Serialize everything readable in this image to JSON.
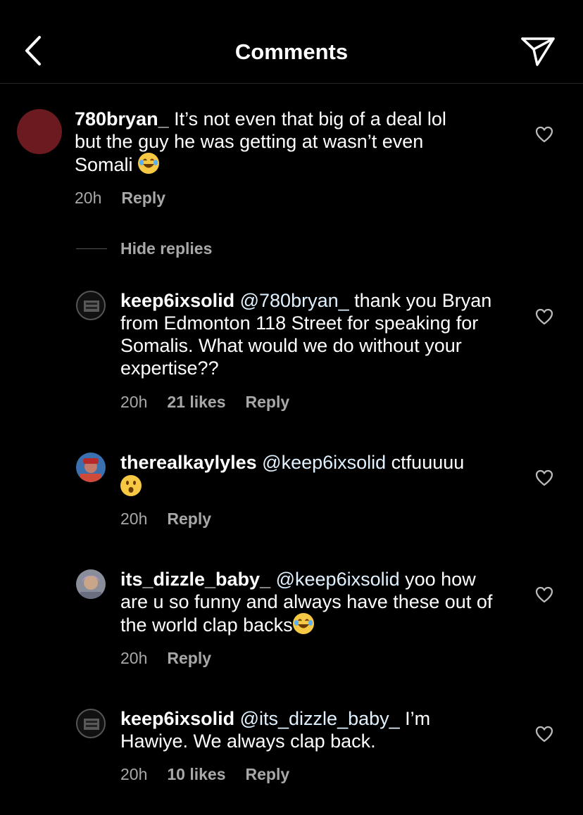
{
  "header": {
    "title": "Comments",
    "back_icon": "chevron-left-icon",
    "share_icon": "send-icon"
  },
  "main_comment": {
    "username": "780bryan_",
    "text": " It’s not even that big of a deal lol but the guy he was getting at wasn’t even Somali ",
    "emoji": "laughing-emoji",
    "time": "20h",
    "reply_label": "Reply",
    "avatar_color": "#6b1a1f"
  },
  "hide_replies_label": "Hide replies",
  "replies": [
    {
      "username": "keep6ixsolid",
      "mention": "@780bryan_",
      "text": " thank you Bryan from Edmonton 118 Street for speaking for Somalis. What would we do without your expertise??",
      "time": "20h",
      "likes": "21 likes",
      "reply_label": "Reply"
    },
    {
      "username": "therealkaylyles",
      "mention": "@keep6ixsolid",
      "text": " ctfuuuuu",
      "emoji": "surprised-emoji",
      "time": "20h",
      "reply_label": "Reply"
    },
    {
      "username": "its_dizzle_baby_",
      "mention": "@keep6ixsolid",
      "text": " yoo how are u so funny and always have these out of the world clap backs",
      "emoji": "laughing-emoji",
      "time": "20h",
      "reply_label": "Reply"
    },
    {
      "username": "keep6ixsolid",
      "mention": "@its_dizzle_baby_",
      "text": " I’m Hawiye. We always clap back.",
      "time": "20h",
      "likes": "10 likes",
      "reply_label": "Reply"
    }
  ]
}
